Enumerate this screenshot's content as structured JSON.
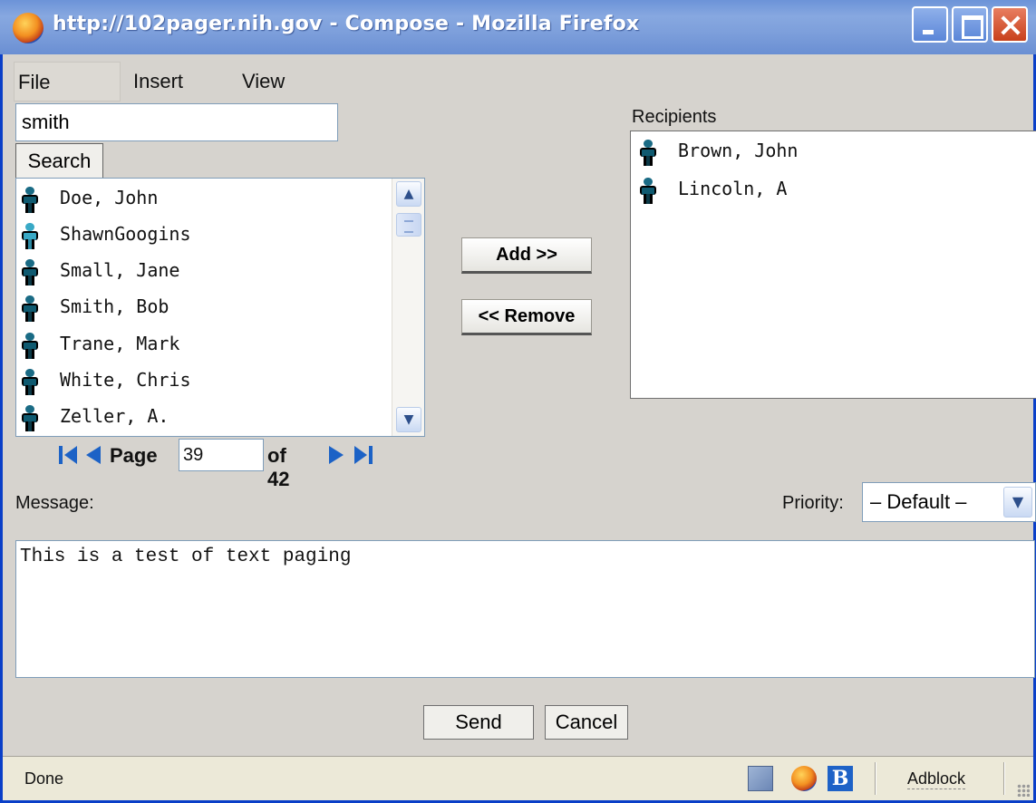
{
  "window": {
    "title": "http://102pager.nih.gov - Compose - Mozilla Firefox"
  },
  "menu": {
    "items": [
      "File",
      "Insert",
      "View"
    ]
  },
  "search": {
    "value": "smith",
    "button_label": "Search"
  },
  "results": {
    "items": [
      {
        "name": "Doe, John",
        "highlighted": false
      },
      {
        "name": "ShawnGoogins",
        "highlighted": true
      },
      {
        "name": "Small, Jane",
        "highlighted": false
      },
      {
        "name": "Smith, Bob",
        "highlighted": false
      },
      {
        "name": "Trane, Mark",
        "highlighted": false
      },
      {
        "name": "White, Chris",
        "highlighted": false
      },
      {
        "name": "Zeller, A.",
        "highlighted": false
      }
    ]
  },
  "pager": {
    "page_label": "Page",
    "page_value": "39",
    "of_label": "of 42"
  },
  "actions": {
    "add_label": "Add >>",
    "remove_label": "<< Remove"
  },
  "recipients": {
    "label": "Recipients",
    "items": [
      "Brown, John",
      "Lincoln, A"
    ]
  },
  "message": {
    "label": "Message:",
    "value": "This is a test of text paging"
  },
  "priority": {
    "label": "Priority:",
    "value": "– Default –"
  },
  "buttons": {
    "send_label": "Send",
    "cancel_label": "Cancel"
  },
  "statusbar": {
    "status": "Done",
    "adblock_label": "Adblock",
    "b_icon_label": "B"
  },
  "colors": {
    "titlebar": "#7d9fdb",
    "window_bg": "#d6d3ce",
    "pager_arrow": "#1c62c6"
  }
}
